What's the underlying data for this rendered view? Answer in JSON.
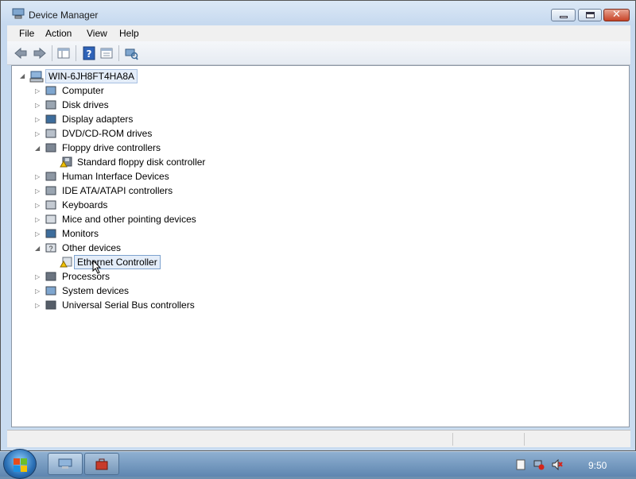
{
  "window": {
    "title": "Device Manager"
  },
  "menu": {
    "file": "File",
    "action": "Action",
    "view": "View",
    "help": "Help"
  },
  "tree": {
    "root": "WIN-6JH8FT4HA8A",
    "items": [
      {
        "label": "Computer",
        "icon": "computer-icon",
        "expanded": false
      },
      {
        "label": "Disk drives",
        "icon": "disk-drive-icon",
        "expanded": false
      },
      {
        "label": "Display adapters",
        "icon": "display-adapter-icon",
        "expanded": false
      },
      {
        "label": "DVD/CD-ROM drives",
        "icon": "dvd-drive-icon",
        "expanded": false
      },
      {
        "label": "Floppy drive controllers",
        "icon": "floppy-controller-icon",
        "expanded": true
      },
      {
        "label": "Human Interface Devices",
        "icon": "hid-icon",
        "expanded": false
      },
      {
        "label": "IDE ATA/ATAPI controllers",
        "icon": "ide-controller-icon",
        "expanded": false
      },
      {
        "label": "Keyboards",
        "icon": "keyboard-icon",
        "expanded": false
      },
      {
        "label": "Mice and other pointing devices",
        "icon": "mouse-icon",
        "expanded": false
      },
      {
        "label": "Monitors",
        "icon": "monitor-icon",
        "expanded": false
      },
      {
        "label": "Other devices",
        "icon": "other-devices-icon",
        "expanded": true
      },
      {
        "label": "Processors",
        "icon": "processor-icon",
        "expanded": false
      },
      {
        "label": "System devices",
        "icon": "system-devices-icon",
        "expanded": false
      },
      {
        "label": "Universal Serial Bus controllers",
        "icon": "usb-icon",
        "expanded": false
      }
    ],
    "floppy_child": "Standard floppy disk controller",
    "other_child": "Ethernet Controller"
  },
  "taskbar": {
    "clock": "9:50"
  },
  "colors": {
    "selection": "#e4edf9",
    "warning": "#f2c200"
  }
}
